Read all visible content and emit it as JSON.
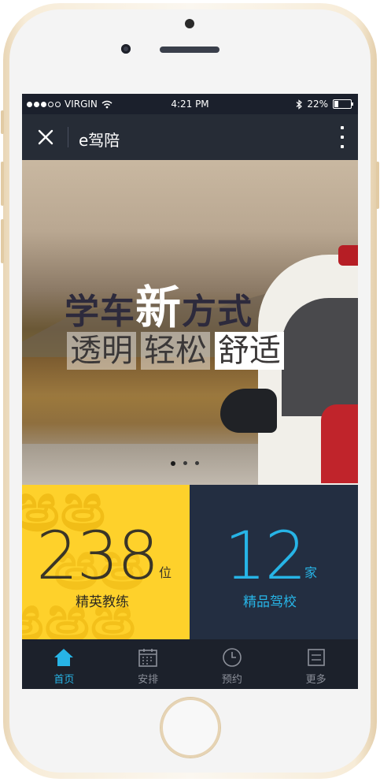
{
  "status_bar": {
    "carrier": "VIRGIN",
    "time": "4:21 PM",
    "battery": "22%"
  },
  "nav": {
    "title": "e驾陪"
  },
  "banner": {
    "headline_part1": "学车",
    "headline_big": "新",
    "headline_part2": "方式",
    "tags": [
      "透明",
      "轻松",
      "舒适"
    ],
    "pager_count": 3,
    "pager_active": 0
  },
  "stats": {
    "coaches": {
      "value": "238",
      "unit": "位",
      "label": "精英教练"
    },
    "schools": {
      "value": "12",
      "unit": "家",
      "label": "精品驾校"
    }
  },
  "tab_bar": {
    "items": [
      {
        "label": "首页",
        "icon": "home-icon",
        "active": true
      },
      {
        "label": "安排",
        "icon": "calendar-icon",
        "active": false
      },
      {
        "label": "预约",
        "icon": "clock-icon",
        "active": false
      },
      {
        "label": "更多",
        "icon": "menu-icon",
        "active": false
      }
    ]
  },
  "colors": {
    "accent": "#27b4e6",
    "yellow": "#fed12b",
    "navy": "#232e41"
  }
}
